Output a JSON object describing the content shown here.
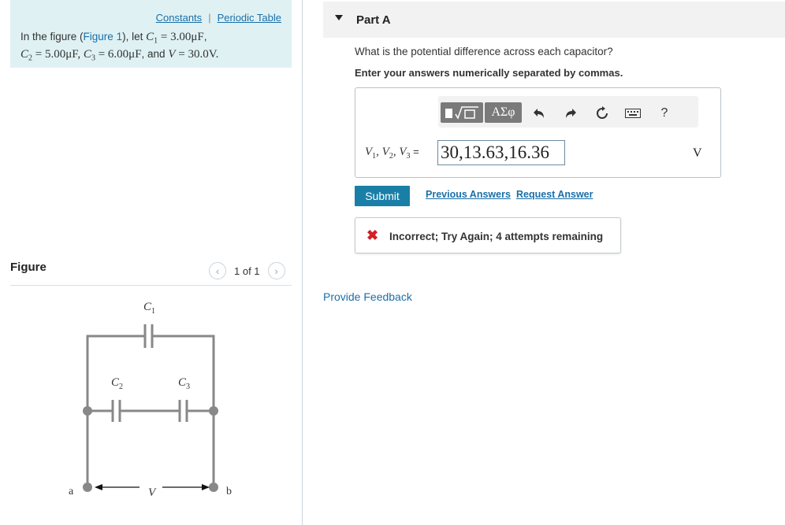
{
  "links": {
    "constants": "Constants",
    "separator": "|",
    "periodic_table": "Periodic Table"
  },
  "problem": {
    "line1_prefix": "In the figure (",
    "figure_link": "Figure 1",
    "line1_mid": "), let ",
    "c1_sym": "C",
    "c1_sub": "1",
    "c1_val": " = 3.00μF",
    "line1_end": ",",
    "c2_sym": "C",
    "c2_sub": "2",
    "c2_val": " = 5.00μF, ",
    "c3_sym": "C",
    "c3_sub": "3",
    "c3_val": " = 6.00μF",
    "and_text": ", and ",
    "v_sym": "V",
    "v_val": " = 30.0V."
  },
  "figure": {
    "title": "Figure",
    "pager_text": "1 of 1",
    "prev_icon": "chevron-left-icon",
    "next_icon": "chevron-right-icon",
    "labels": {
      "c1": "C",
      "c1_sub": "1",
      "c2": "C",
      "c2_sub": "2",
      "c3": "C",
      "c3_sub": "3",
      "a": "a",
      "b": "b",
      "v": "V"
    }
  },
  "part": {
    "title": "Part A"
  },
  "question": "What is the potential difference across each capacitor?",
  "instruction": "Enter your answers numerically separated by commas.",
  "toolbar": {
    "greek": "ΑΣφ",
    "icons": [
      "templates-icon",
      "greek-letters-icon",
      "undo-icon",
      "redo-icon",
      "reset-icon",
      "keyboard-icon",
      "help-icon"
    ],
    "help": "?"
  },
  "answer": {
    "label_v1": "V",
    "label_sub1": "1",
    "label_v2": "V",
    "label_sub2": "2",
    "label_v3": "V",
    "label_sub3": "3",
    "label_eq": " =",
    "value": "30,13.63,16.36",
    "unit": "V"
  },
  "buttons": {
    "submit": "Submit",
    "previous_answers": "Previous Answers",
    "request_answer": "Request Answer"
  },
  "feedback": {
    "icon": "x-icon",
    "text": "Incorrect; Try Again; 4 attempts remaining"
  },
  "provide_feedback": "Provide Feedback",
  "colors": {
    "accent": "#1a7fa6",
    "error": "#d41f26",
    "intro_bg": "#dff1f3",
    "link": "#1a6fa8"
  }
}
